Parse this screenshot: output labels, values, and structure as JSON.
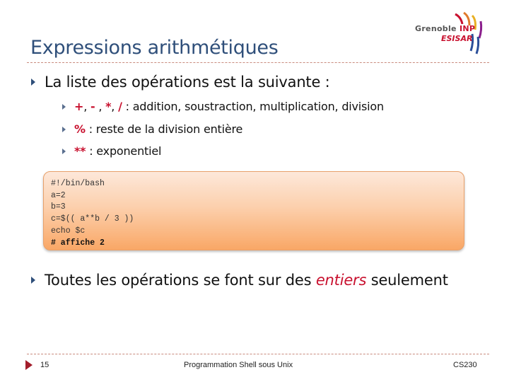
{
  "slide": {
    "title": "Expressions arithmétiques",
    "logo": {
      "line1": "Grenoble",
      "line1_accent": "INP",
      "line2": "ESISAR"
    },
    "bullets": {
      "b1": "La liste des opérations est la suivante :",
      "b1_sub": [
        {
          "ops": [
            "+",
            "-",
            "*",
            "/"
          ],
          "sep": ",",
          "text": " : addition, soustraction, multiplication, division"
        },
        {
          "op": "%",
          "text": " : reste de la division entière"
        },
        {
          "op": "**",
          "text": " : exponentiel"
        }
      ],
      "b2_before": "Toutes les opérations se font sur des ",
      "b2_em": "entiers",
      "b2_after": " seulement"
    },
    "code": [
      "#!/bin/bash",
      "a=2",
      "b=3",
      "c=$(( a**b / 3 ))",
      "echo $c",
      "# affiche 2"
    ],
    "footer": {
      "page": "15",
      "center": "Programmation Shell sous Unix",
      "right": "CS230"
    }
  },
  "colors": {
    "title": "#2f4f7a",
    "accent_red": "#c8102e",
    "code_bg_bottom": "#f9a766"
  }
}
